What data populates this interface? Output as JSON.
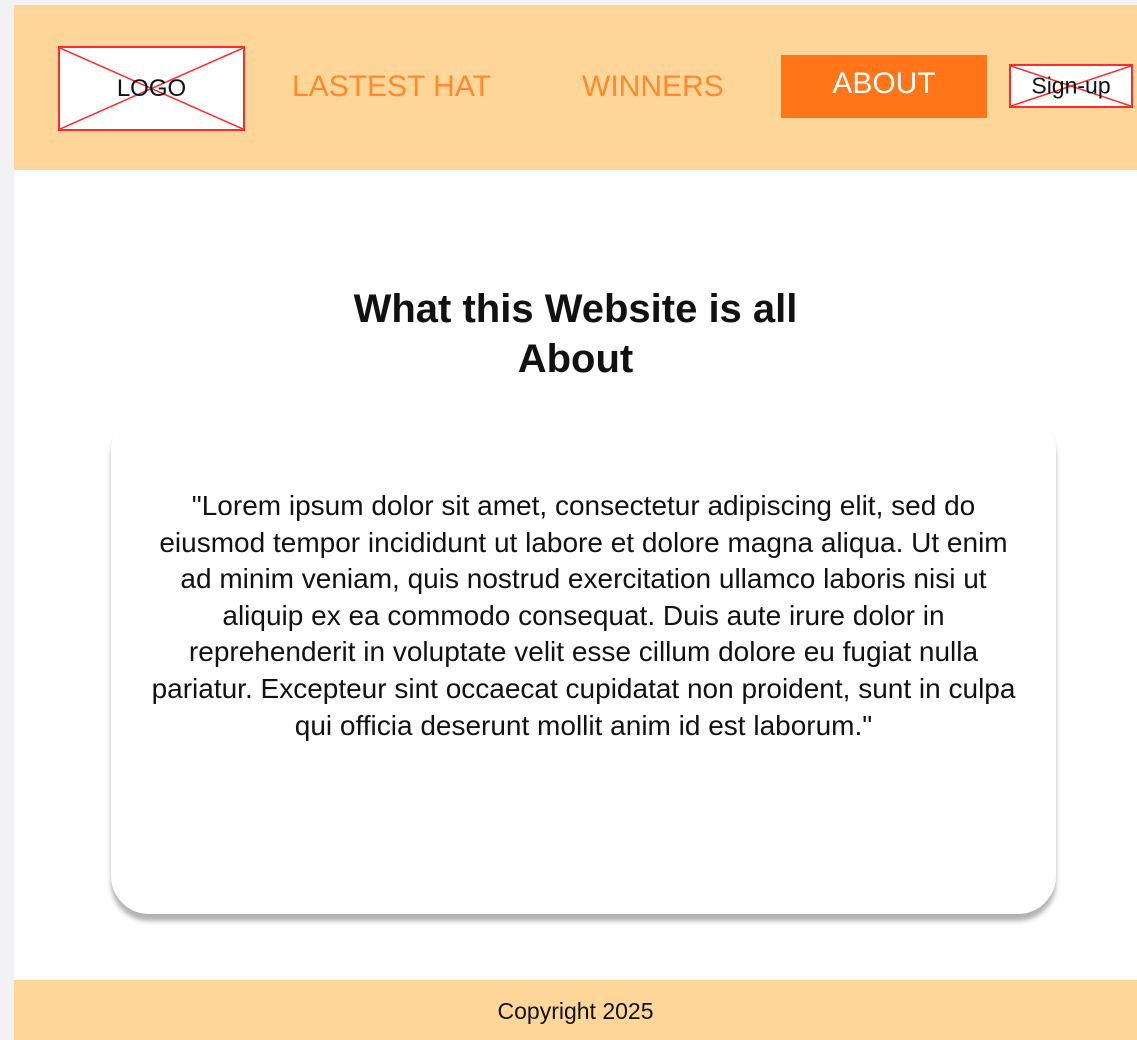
{
  "header": {
    "logo_label": "LOGO",
    "signup_label": "Sign-up",
    "nav": {
      "latest_hat": "LASTEST HAT",
      "winners": "WINNERS",
      "about": "ABOUT"
    }
  },
  "main": {
    "title_line1": "What this Website is all",
    "title_line2": "About",
    "quote": "\"Lorem ipsum dolor sit amet, consectetur adipiscing elit, sed do eiusmod tempor incididunt ut labore et dolore magna aliqua. Ut enim ad minim veniam, quis nostrud exercitation ullamco laboris nisi ut aliquip ex ea commodo consequat. Duis aute irure dolor in reprehenderit in voluptate velit esse cillum dolore eu fugiat nulla pariatur. Excepteur sint occaecat cupidatat non proident, sunt in culpa qui officia deserunt mollit anim id est laborum.\""
  },
  "footer": {
    "copyright": "Copyright 2025"
  },
  "colors": {
    "header_bg": "#ffd699",
    "nav_text": "#ff8a2b",
    "active_nav_bg": "#ff7518",
    "placeholder_border": "#ff2a2a"
  }
}
